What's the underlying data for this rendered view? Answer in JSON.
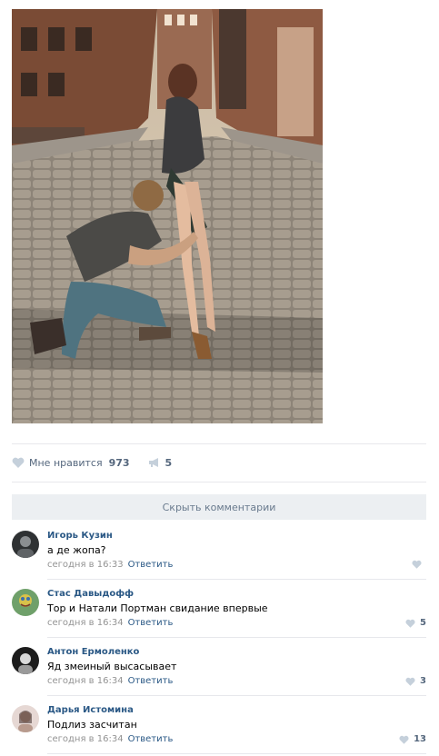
{
  "post": {
    "photo_alt": "photo",
    "likes": {
      "label": "Мне нравится",
      "count": "973",
      "icon": "heart-icon"
    },
    "shares": {
      "count": "5",
      "icon": "megaphone-icon"
    }
  },
  "comments_section": {
    "hide_label": "Скрыть комментарии",
    "items": [
      {
        "author": "Игорь Кузин",
        "text": "а де жопа?",
        "date": "сегодня в 16:33",
        "reply": "Ответить",
        "likes": ""
      },
      {
        "author": "Стас Давыдофф",
        "text": "Тор и Натали Портман свидание впервые",
        "date": "сегодня в 16:34",
        "reply": "Ответить",
        "likes": "5"
      },
      {
        "author": "Антон Ермоленко",
        "text": "Яд змеиный высасывает",
        "date": "сегодня в 16:34",
        "reply": "Ответить",
        "likes": "3"
      },
      {
        "author": "Дарья Истомина",
        "text": "Подлиз засчитан",
        "date": "сегодня в 16:34",
        "reply": "Ответить",
        "likes": "13"
      }
    ]
  },
  "colors": {
    "link": "#2a5885",
    "meta": "#939393",
    "action": "#55677d",
    "divider": "#e7e8ec"
  }
}
